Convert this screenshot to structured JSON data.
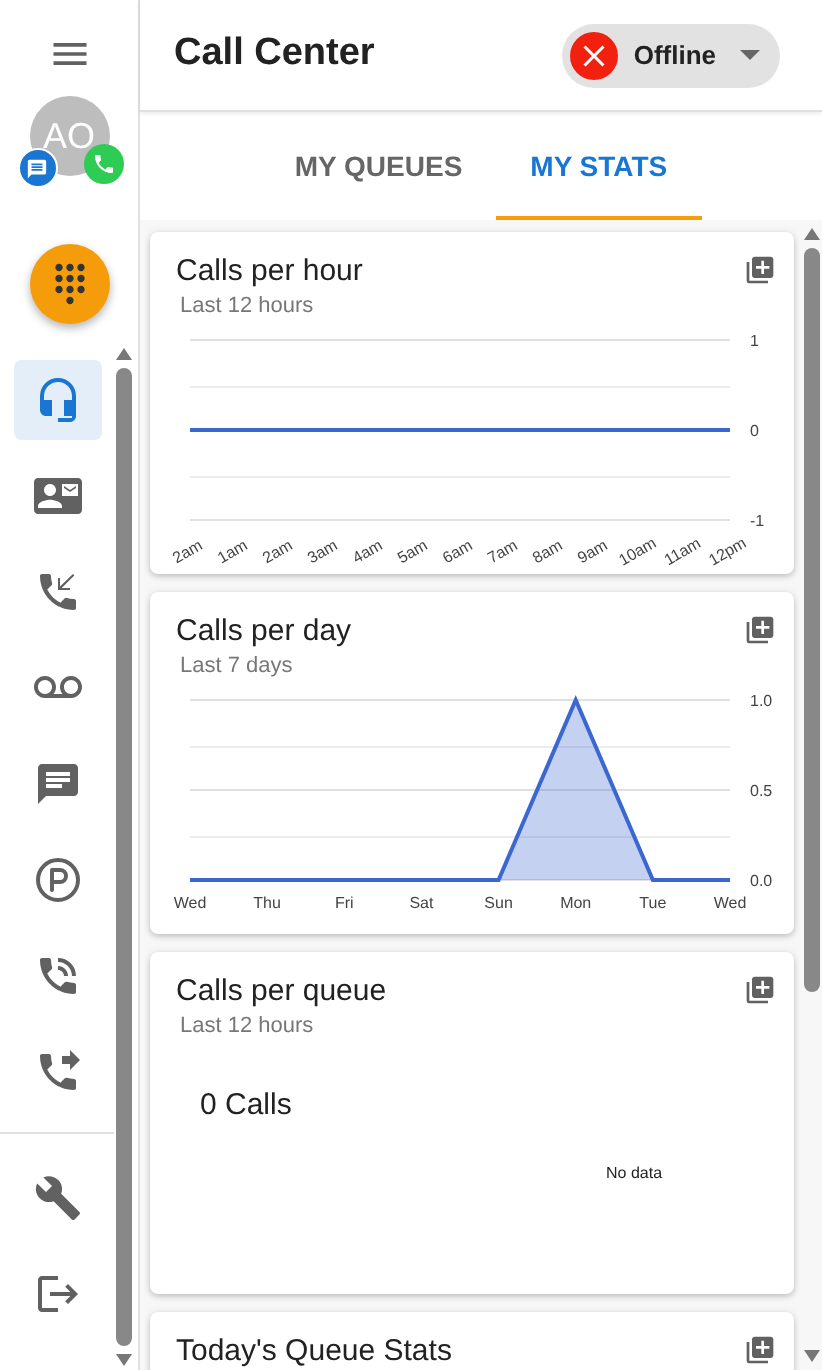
{
  "sidebar": {
    "avatar": {
      "initials": "AO"
    },
    "nav_items": [
      {
        "kind": "headset",
        "selected": true
      },
      {
        "kind": "contacts",
        "selected": false
      },
      {
        "kind": "callback",
        "selected": false
      },
      {
        "kind": "voicemail",
        "selected": false
      },
      {
        "kind": "chat",
        "selected": false
      },
      {
        "kind": "parking",
        "selected": false
      },
      {
        "kind": "ringing",
        "selected": false
      },
      {
        "kind": "forwarded",
        "selected": false
      }
    ],
    "bottom_items": [
      {
        "kind": "settings"
      },
      {
        "kind": "logout"
      }
    ]
  },
  "header": {
    "title": "Call Center",
    "status": {
      "label": "Offline"
    }
  },
  "tabs": [
    {
      "label": "MY QUEUES",
      "selected": false
    },
    {
      "label": "MY STATS",
      "selected": true
    }
  ],
  "cards": [
    {
      "title": "Calls per hour",
      "subtitle": "Last 12 hours",
      "chart_data": {
        "type": "line",
        "categories": [
          "2am",
          "1am",
          "2am",
          "3am",
          "4am",
          "5am",
          "6am",
          "7am",
          "8am",
          "9am",
          "10am",
          "11am",
          "12pm"
        ],
        "series": [
          {
            "color": "#3b67d0",
            "values": [
              0,
              0,
              0,
              0,
              0,
              0,
              0,
              0,
              0,
              0,
              0,
              0,
              0
            ]
          }
        ],
        "ylim": [
          -1,
          1
        ],
        "yticks": [
          -1,
          0,
          1
        ]
      }
    },
    {
      "title": "Calls per day",
      "subtitle": "Last 7 days",
      "chart_data": {
        "type": "area",
        "categories": [
          "Wed",
          "Thu",
          "Fri",
          "Sat",
          "Sun",
          "Mon",
          "Tue",
          "Wed"
        ],
        "series": [
          {
            "color": "#3b67d0",
            "values": [
              0,
              0,
              0,
              0,
              0,
              1,
              0,
              0
            ]
          }
        ],
        "ylim": [
          0,
          1
        ],
        "yticks": [
          {
            "value": 0,
            "label": "0.0"
          },
          {
            "value": 0.5,
            "label": "0.5"
          },
          {
            "value": 1,
            "label": "1.0"
          }
        ]
      }
    },
    {
      "title": "Calls per queue",
      "subtitle": "Last 12 hours",
      "total": "0 Calls",
      "empty_text": "No data"
    },
    {
      "title": "Today's Queue Stats"
    }
  ]
}
